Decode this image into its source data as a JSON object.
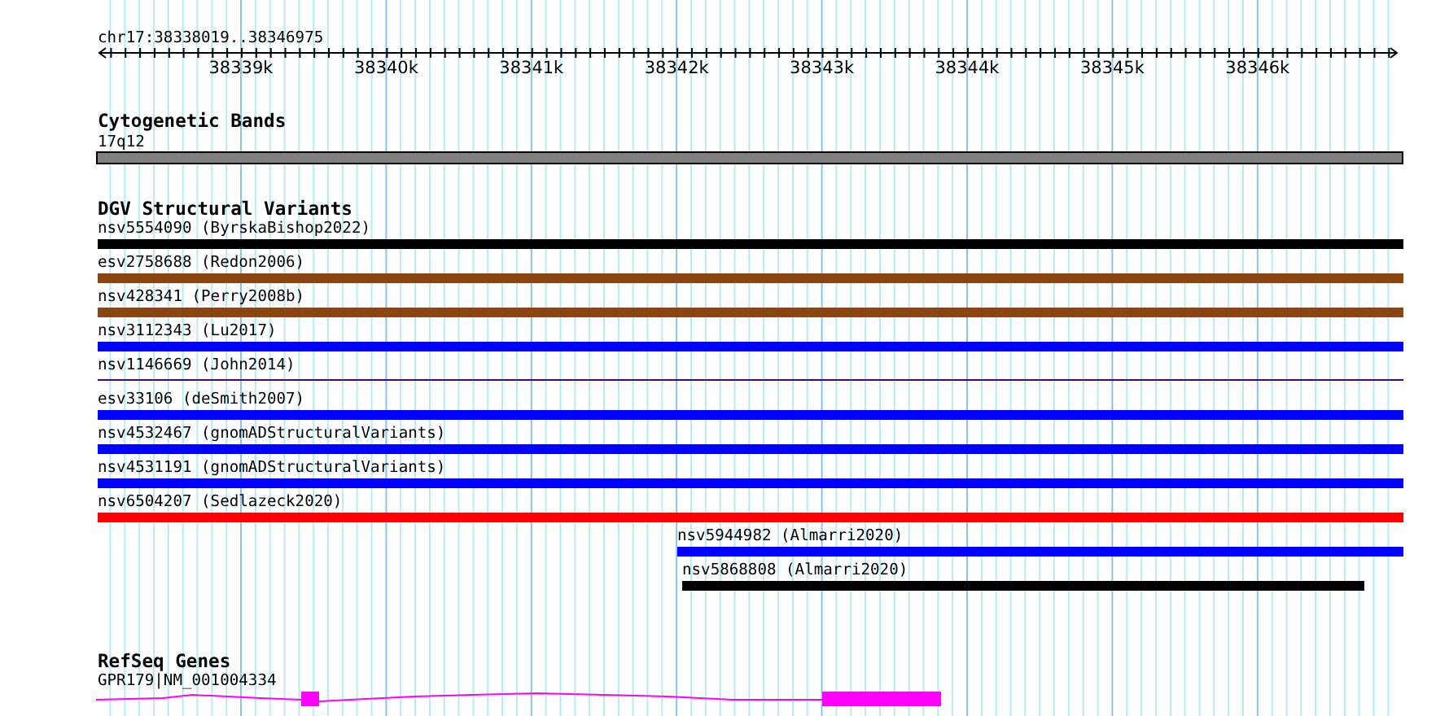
{
  "ruler": {
    "location": "chr17:38338019..38346975",
    "ticks": [
      "38339k",
      "38340k",
      "38341k",
      "38342k",
      "38343k",
      "38344k",
      "38345k",
      "38346k"
    ]
  },
  "tracks": [
    {
      "title": "Cytogenetic Bands",
      "features": [
        {
          "label": "17q12",
          "kind": "band",
          "color": "#808080"
        }
      ]
    },
    {
      "title": "DGV Structural Variants",
      "features": [
        {
          "label": "nsv5554090 (ByrskaBishop2022)",
          "kind": "bar",
          "color": "#000000"
        },
        {
          "label": "esv2758688 (Redon2006)",
          "kind": "bar",
          "color": "#8b4513"
        },
        {
          "label": "nsv428341 (Perry2008b)",
          "kind": "bar",
          "color": "#8b4513"
        },
        {
          "label": "nsv3112343 (Lu2017)",
          "kind": "bar",
          "color": "#0000ff"
        },
        {
          "label": "nsv1146669 (John2014)",
          "kind": "line",
          "color": "#4b0082"
        },
        {
          "label": "esv33106 (deSmith2007)",
          "kind": "bar",
          "color": "#0000ff"
        },
        {
          "label": "nsv4532467 (gnomADStructuralVariants)",
          "kind": "bar",
          "color": "#0000ff"
        },
        {
          "label": "nsv4531191 (gnomADStructuralVariants)",
          "kind": "bar",
          "color": "#0000ff"
        },
        {
          "label": "nsv6504207 (Sedlazeck2020)",
          "kind": "bar",
          "color": "#ff0000"
        },
        {
          "label": "nsv5944982 (Almarri2020)",
          "kind": "bar",
          "color": "#0000ff"
        },
        {
          "label": "nsv5868808 (Almarri2020)",
          "kind": "bar",
          "color": "#000000"
        }
      ]
    },
    {
      "title": "RefSeq Genes",
      "features": [
        {
          "label": "GPR179|NM_001004334",
          "kind": "gene",
          "color": "#ff00ff"
        }
      ]
    }
  ]
}
